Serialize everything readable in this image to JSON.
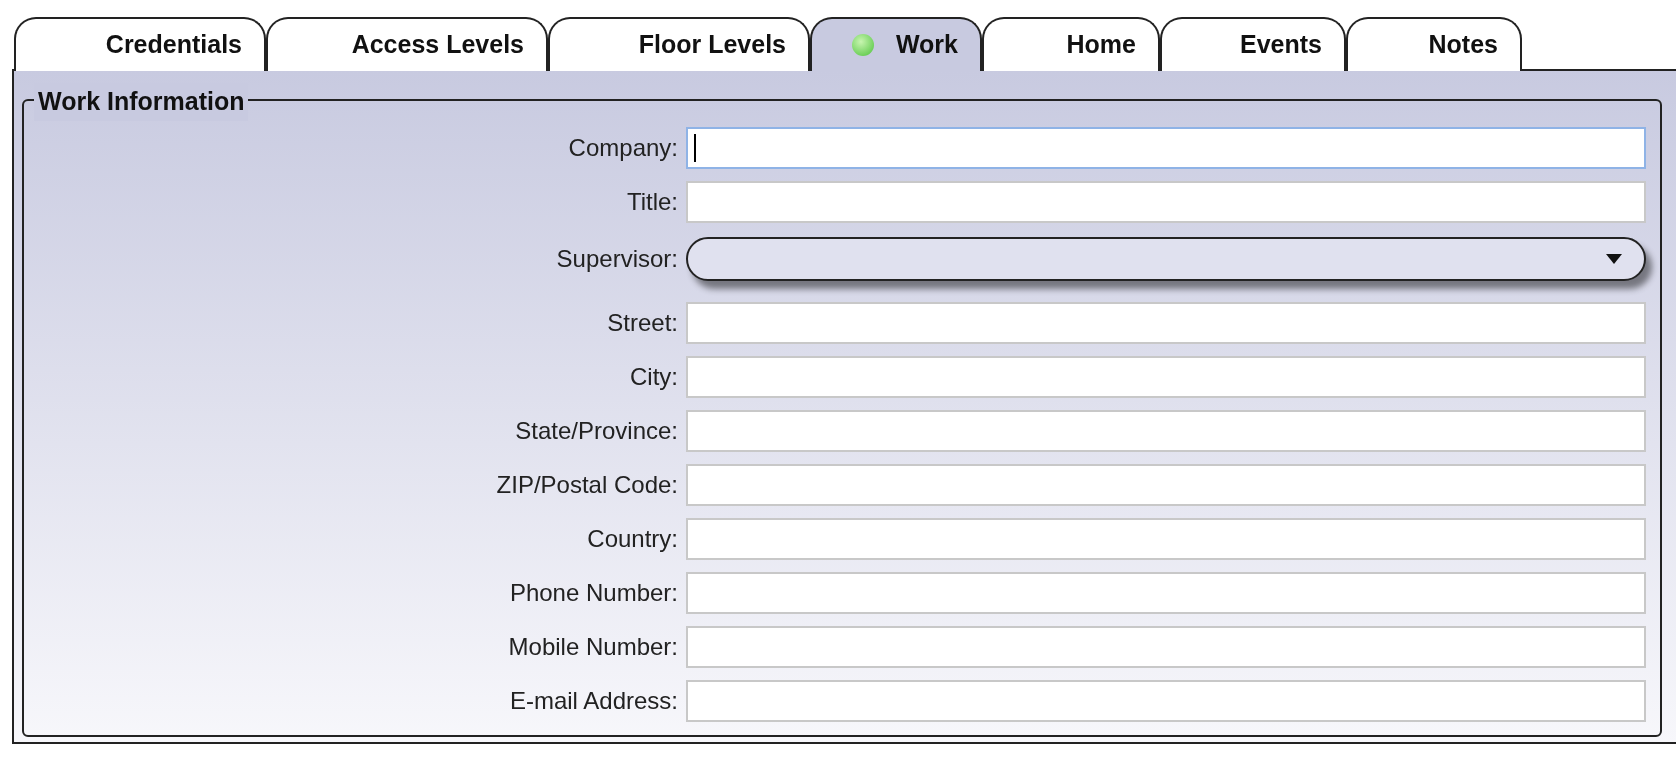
{
  "tabs": [
    {
      "label": "Credentials",
      "selected": false,
      "indicator": false
    },
    {
      "label": "Access Levels",
      "selected": false,
      "indicator": false
    },
    {
      "label": "Floor Levels",
      "selected": false,
      "indicator": false
    },
    {
      "label": "Work",
      "selected": true,
      "indicator": true
    },
    {
      "label": "Home",
      "selected": false,
      "indicator": false
    },
    {
      "label": "Events",
      "selected": false,
      "indicator": false
    },
    {
      "label": "Notes",
      "selected": false,
      "indicator": false
    }
  ],
  "group": {
    "title": "Work Information",
    "fields": [
      {
        "label": "Company:",
        "kind": "text",
        "focused": true
      },
      {
        "label": "Title:",
        "kind": "text",
        "focused": false
      },
      {
        "label": "Supervisor:",
        "kind": "dropdown",
        "focused": false
      },
      {
        "label": "Street:",
        "kind": "text",
        "focused": false
      },
      {
        "label": "City:",
        "kind": "text",
        "focused": false
      },
      {
        "label": "State/Province:",
        "kind": "text",
        "focused": false
      },
      {
        "label": "ZIP/Postal Code:",
        "kind": "text",
        "focused": false
      },
      {
        "label": "Country:",
        "kind": "text",
        "focused": false
      },
      {
        "label": "Phone Number:",
        "kind": "text",
        "focused": false
      },
      {
        "label": "Mobile Number:",
        "kind": "text",
        "focused": false
      },
      {
        "label": "E-mail Address:",
        "kind": "text",
        "focused": false
      }
    ]
  }
}
